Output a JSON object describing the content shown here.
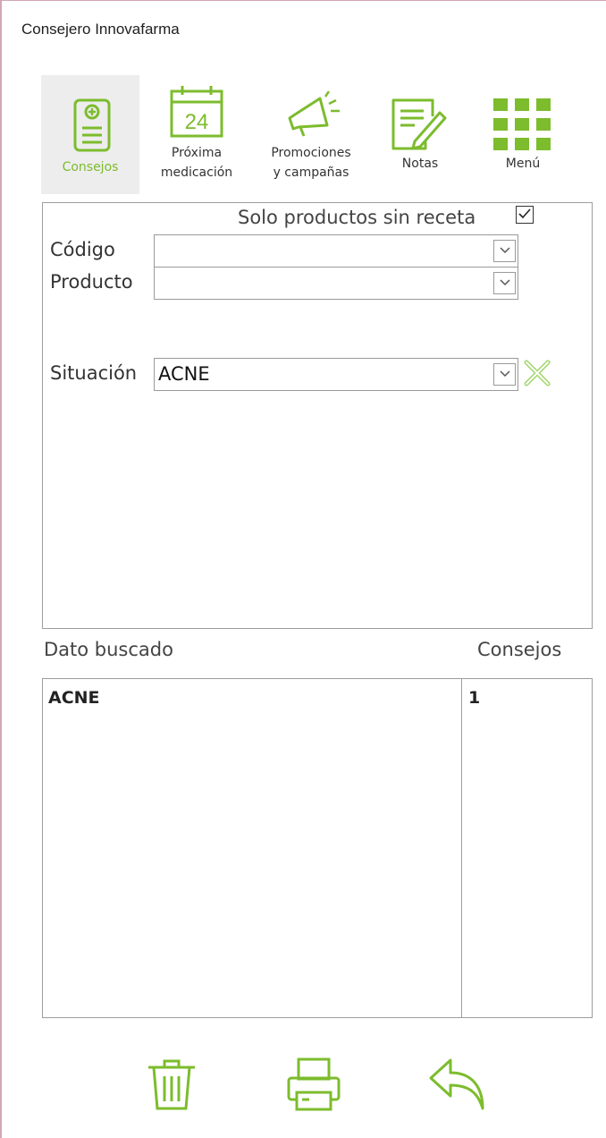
{
  "window": {
    "title": "Consejero Innovafarma"
  },
  "nav": [
    {
      "id": "consejos",
      "label_line1": "Consejos",
      "label_line2": "",
      "icon": "clipboard-plus-icon",
      "active": true
    },
    {
      "id": "proxima",
      "label_line1": "Próxima",
      "label_line2": "medicación",
      "icon": "calendar-icon",
      "calendar_day": "24"
    },
    {
      "id": "promociones",
      "label_line1": "Promociones",
      "label_line2": "y campañas",
      "icon": "megaphone-icon"
    },
    {
      "id": "notas",
      "label_line1": "Notas",
      "label_line2": "",
      "icon": "notes-pencil-icon"
    },
    {
      "id": "menu",
      "label_line1": "Menú",
      "label_line2": "",
      "icon": "grid-menu-icon"
    }
  ],
  "filters": {
    "solo_label": "Solo productos sin receta",
    "solo_checked": true,
    "codigo_label": "Código",
    "codigo_value": "",
    "producto_label": "Producto",
    "producto_value": "",
    "situacion_label": "Situación",
    "situacion_value": "ACNE"
  },
  "results": {
    "col_dato": "Dato buscado",
    "col_consejos": "Consejos",
    "rows": [
      {
        "dato": "ACNE",
        "consejos": "1"
      }
    ]
  },
  "actions": [
    "trash-icon",
    "printer-icon",
    "undo-arrow-icon"
  ],
  "colors": {
    "accent": "#7cbc2d",
    "active_bg": "#ededed",
    "border": "#9d9d9d"
  }
}
